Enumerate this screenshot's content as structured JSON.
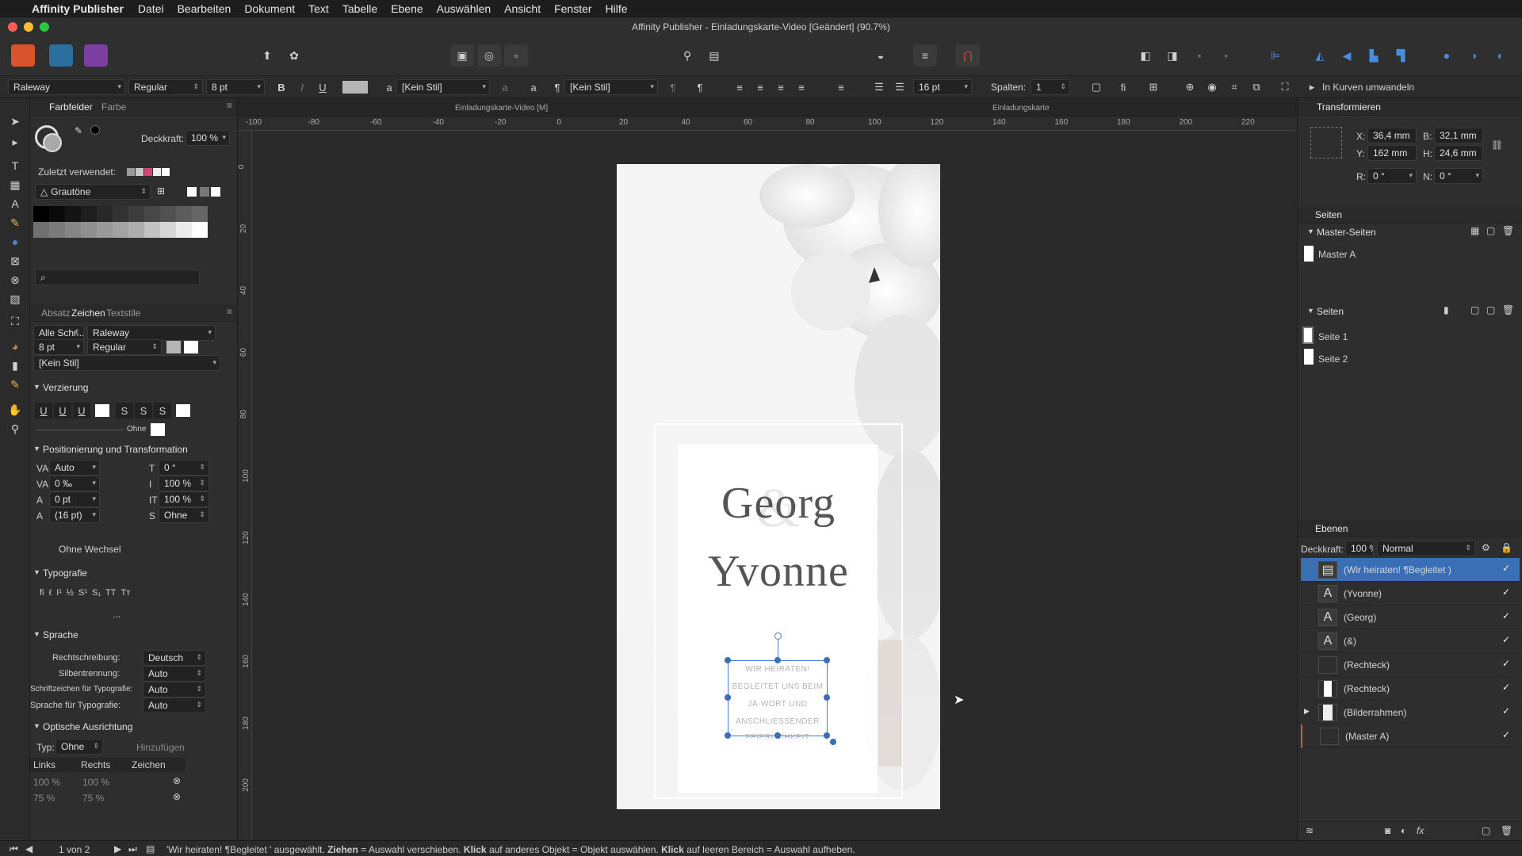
{
  "menubar": {
    "app": "Affinity Publisher",
    "items": [
      "Datei",
      "Bearbeiten",
      "Dokument",
      "Text",
      "Tabelle",
      "Ebene",
      "Auswählen",
      "Ansicht",
      "Fenster",
      "Hilfe"
    ]
  },
  "window": {
    "title": "Affinity Publisher - Einladungskarte-Video [Geändert] (90.7%)"
  },
  "context": {
    "font": "Raleway",
    "weight": "Regular",
    "size": "8 pt",
    "bold": "B",
    "italic": "I",
    "underline": "U",
    "char_style": "[Kein Stil]",
    "para_style": "[Kein Stil]",
    "leading": "16 pt",
    "columns_label": "Spalten:",
    "columns": "1",
    "convert": "In Kurven umwandeln"
  },
  "doctabs": {
    "left": "Einladungskarte-Video [M]",
    "right": "Einladungskarte"
  },
  "ruler": {
    "top": [
      "-100",
      "-80",
      "-60",
      "-40",
      "-20",
      "0",
      "20",
      "40",
      "60",
      "80",
      "100",
      "120",
      "140",
      "160",
      "180",
      "200",
      "220"
    ],
    "left": [
      "0",
      "20",
      "40",
      "60",
      "80",
      "100",
      "120",
      "140",
      "160",
      "180",
      "200"
    ]
  },
  "swatches": {
    "tab1": "Farbfelder",
    "tab2": "Farbe",
    "opacity_label": "Deckkraft:",
    "opacity": "100 %",
    "recent_label": "Zuletzt verwendet:",
    "palette": "Grautöne"
  },
  "character": {
    "tab1": "Absatz",
    "tab2": "Zeichen",
    "tab3": "Textstile",
    "scope": "Alle Schr...",
    "font": "Raleway",
    "size": "8 pt",
    "weight": "Regular",
    "style": "[Kein Stil]",
    "sec_decoration": "Verzierung",
    "decoration_none": "Ohne",
    "sec_position": "Positionierung und Transformation",
    "kerning": "Auto",
    "tracking": "0 ‰",
    "baseline": "0 pt",
    "leading": "(16 pt)",
    "shear": "0 °",
    "vscale": "100 %",
    "hscale": "100 %",
    "case": "Ohne",
    "no_break": "Ohne Wechsel",
    "sec_typo": "Typografie",
    "more": "...",
    "sec_lang": "Sprache",
    "spell_label": "Rechtschreibung:",
    "spell": "Deutsch",
    "hyph_label": "Silbentrennung:",
    "hyph": "Auto",
    "script_label": "Schriftzeichen für Typografie:",
    "script": "Auto",
    "lang_label": "Sprache für Typografie:",
    "lang": "Auto",
    "sec_optical": "Optische Ausrichtung",
    "type_label": "Typ:",
    "type": "Ohne",
    "add": "Hinzufügen",
    "col_left": "Links",
    "col_right": "Rechts",
    "col_char": "Zeichen",
    "row1_left": "100 %",
    "row1_right": "100 %",
    "row2_left": "75 %",
    "row2_right": "75 %"
  },
  "transform": {
    "title": "Transformieren",
    "x_label": "X:",
    "x": "36,4 mm",
    "w_label": "B:",
    "w": "32,1 mm",
    "y_label": "Y:",
    "y": "162 mm",
    "h_label": "H:",
    "h": "24,6 mm",
    "r_label": "R:",
    "r": "0 °",
    "n_label": "N:",
    "n": "0 °"
  },
  "pages": {
    "title": "Seiten",
    "master_section": "Master-Seiten",
    "master": "Master A",
    "pages_section": "Seiten",
    "page1": "Seite 1",
    "page2": "Seite 2"
  },
  "layers": {
    "title": "Ebenen",
    "opacity_label": "Deckkraft:",
    "opacity": "100 %",
    "blend": "Normal",
    "items": [
      {
        "name": "(Wir heiraten! ¶Begleitet )"
      },
      {
        "name": "(Yvonne)"
      },
      {
        "name": "(Georg)"
      },
      {
        "name": "(&)"
      },
      {
        "name": "(Rechteck)"
      },
      {
        "name": "(Rechteck)"
      },
      {
        "name": "(Bilderrahmen)"
      },
      {
        "name": "(Master A)"
      }
    ]
  },
  "card": {
    "name1": "Georg",
    "name2": "Yvonne",
    "ampersand": "&",
    "line1": "WIR HEIRATEN!",
    "line2": "BEGLEITET UNS BEIM",
    "line3": "JA-WORT UND",
    "line4": "ANSCHLIESSENDER",
    "line5": "FEIERLICHKEIT"
  },
  "status": {
    "pages": "1 von 2",
    "msg_sel": "'Wir heiraten! ¶Begleitet ' ausgewählt.",
    "drag": "Ziehen",
    "drag_t": "= Auswahl verschieben.",
    "click1": "Klick",
    "click1_t": "auf anderes Objekt = Objekt auswählen.",
    "click2": "Klick",
    "click2_t": "auf leeren Bereich = Auswahl aufheben."
  },
  "colors": {
    "accent": "#3b6fb5",
    "selection": "#4a7bd0",
    "panel": "#2e2e2e"
  }
}
